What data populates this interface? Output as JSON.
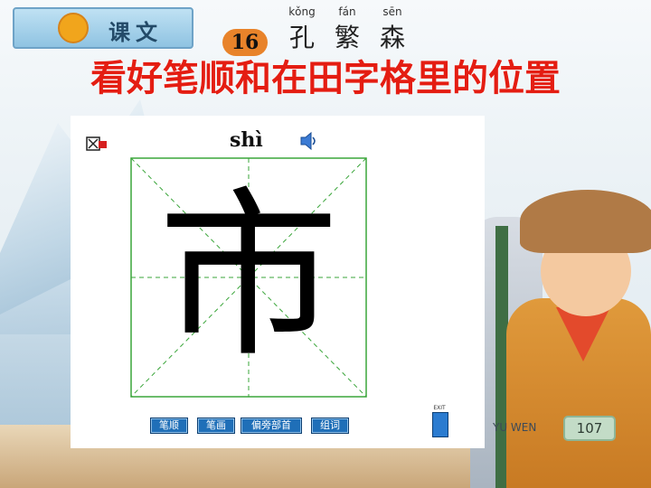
{
  "banner": {
    "section_label": "课文",
    "lesson_number": "16",
    "title_words": [
      {
        "pinyin": "kǒng",
        "hanzi": "孔"
      },
      {
        "pinyin": "fán",
        "hanzi": "繁"
      },
      {
        "pinyin": "sēn",
        "hanzi": "森"
      }
    ]
  },
  "heading": "看好笔顺和在田字格里的位置",
  "panel": {
    "pinyin": "shì",
    "character": "市",
    "buttons": [
      {
        "label": "笔顺"
      },
      {
        "label": "笔画"
      },
      {
        "label": "偏旁部首"
      },
      {
        "label": "组词"
      }
    ],
    "exit_label": "EXIT",
    "grid_color": "#3aa53a"
  },
  "footer": {
    "subject": "YU WEN",
    "page_number": "107"
  }
}
